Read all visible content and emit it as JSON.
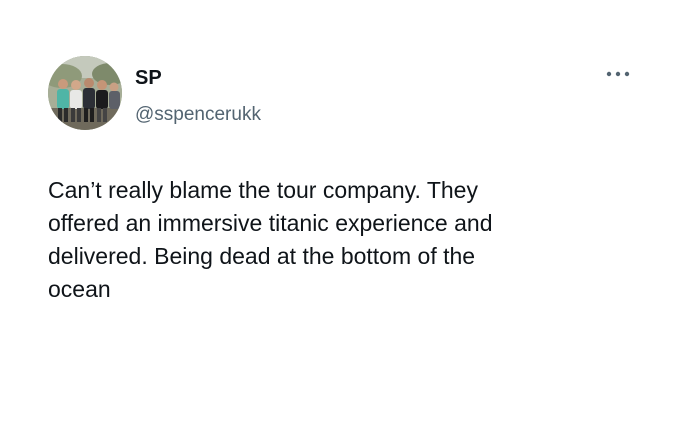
{
  "tweet": {
    "display_name": "SP",
    "handle": "@sspencerukk",
    "more_icon": "more-horizontal-icon",
    "text_lines": [
      "Can’t really blame the tour company. They",
      "offered an immersive titanic experience and",
      "delivered. Being dead at the bottom of the",
      "ocean"
    ]
  },
  "colors": {
    "background": "#ffffff",
    "text_primary": "#0f1419",
    "text_secondary": "#536471"
  }
}
